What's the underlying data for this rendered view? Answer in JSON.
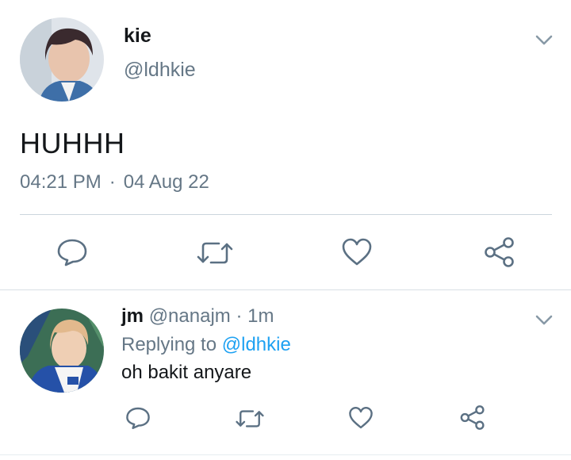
{
  "tweet": {
    "author_name": "kie",
    "author_handle": "@ldhkie",
    "text": "HUHHH",
    "time": "04:21 PM",
    "separator": "·",
    "date": "04 Aug 22"
  },
  "reply": {
    "author_name": "jm",
    "author_handle": "@nanajm",
    "separator": "·",
    "time_ago": "1m",
    "replying_to_label": "Replying to",
    "replying_to_handle": "@ldhkie",
    "text": "oh bakit anyare"
  },
  "icons": {
    "menu": "chevron-down-icon",
    "reply": "reply-bubble-icon",
    "retweet": "retweet-icon",
    "like": "heart-icon",
    "share": "share-icon"
  },
  "colors": {
    "text_primary": "#14171a",
    "text_secondary": "#657786",
    "link": "#1da1f2",
    "divider": "#ccd6dd"
  }
}
